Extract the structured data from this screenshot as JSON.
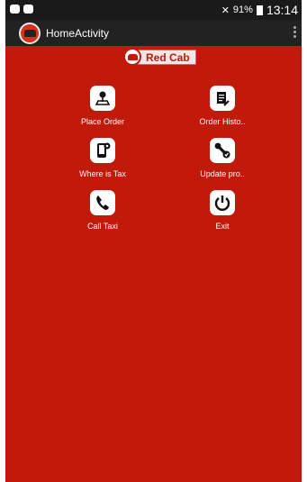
{
  "status_bar": {
    "signal": "✕",
    "battery": "91%",
    "time": "13:14"
  },
  "toolbar": {
    "title": "HomeActivity",
    "logo_icon": "red-cab-car-icon",
    "menu_icon": "overflow-menu-icon"
  },
  "brand": {
    "label": "Red Cab",
    "icon": "car-icon"
  },
  "menu": [
    {
      "label": "Place Order",
      "icon": "map-pin-icon"
    },
    {
      "label": "Order Histo..",
      "icon": "document-pen-icon"
    },
    {
      "label": "Where is Tax",
      "icon": "phone-location-icon"
    },
    {
      "label": "Update pro..",
      "icon": "wrench-icon"
    },
    {
      "label": "Call Taxi",
      "icon": "phone-call-icon"
    },
    {
      "label": "Exit",
      "icon": "power-icon"
    }
  ],
  "colors": {
    "background": "#c11a0a",
    "toolbar": "#222222",
    "status_bar": "#1a1a1a"
  }
}
